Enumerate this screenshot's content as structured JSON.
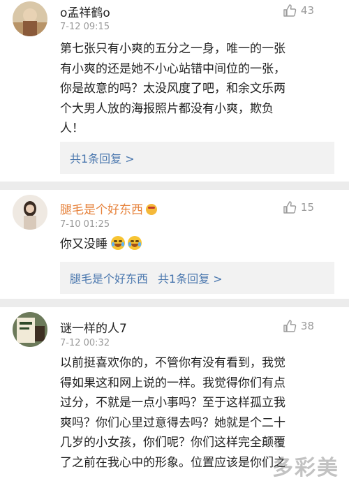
{
  "comments": [
    {
      "username": "o孟祥鹤o",
      "timestamp": "7-12 09:15",
      "likes": "43",
      "lines": [
        "第七张只有小爽的五分之一身，唯一的一张",
        "有小爽的还是她不小心站错中间位的一张，",
        "你是故意的吗？太没风度了吧，和余文乐两",
        "个大男人放的海报照片都没有小爽，欺负",
        "人！"
      ],
      "reply": "共1条回复 >"
    },
    {
      "username": "腿毛是个好东西",
      "timestamp": "7-10 01:25",
      "likes": "15",
      "text": "你又没睡",
      "reply_user": "腿毛是个好东西",
      "reply": "共1条回复 >"
    },
    {
      "username": "谜一样的人7",
      "timestamp": "7-12 00:32",
      "likes": "38",
      "lines": [
        "以前挺喜欢你的，不管你有没有看到，我觉",
        "得如果这和网上说的一样。我觉得你们有点",
        "过分，不就是一点小事吗？至于这样孤立我",
        "爽吗？你们心里过意得去吗？她就是个二十",
        "几岁的小女孩，你们呢？你们这样完全颠覆",
        "了之前在我心中的形象。位置应该是你们之"
      ]
    }
  ],
  "watermark": "多彩美",
  "colors": {
    "link": "#4a77ae",
    "meta": "#9a9a9a",
    "reply_bg": "#f2f2f2"
  }
}
